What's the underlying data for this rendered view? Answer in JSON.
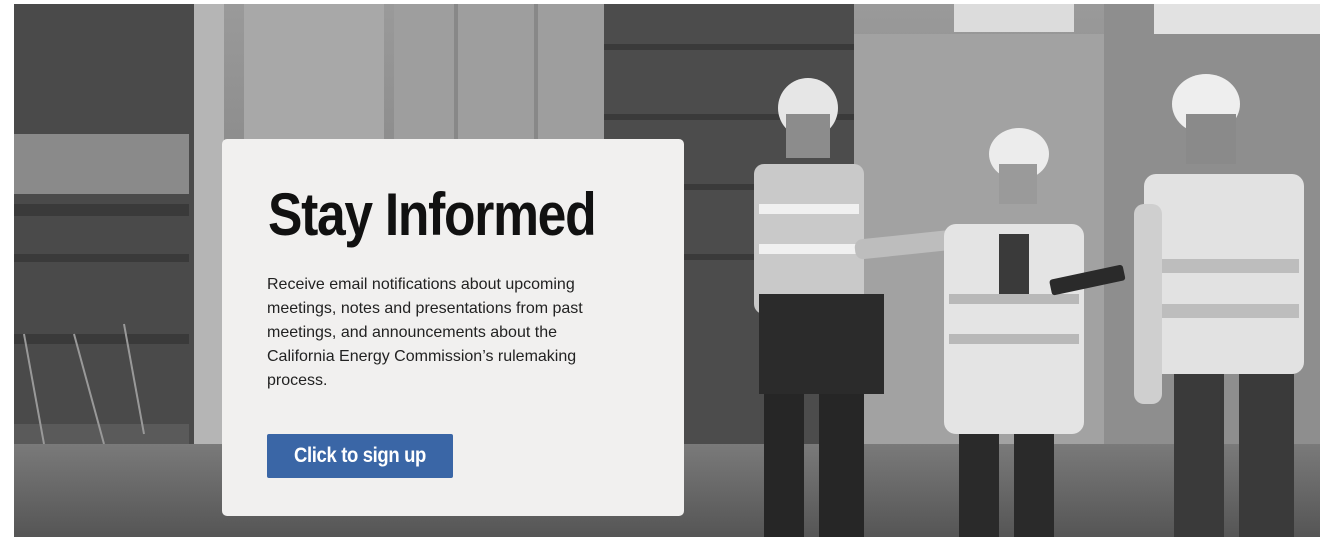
{
  "hero": {
    "title": "Stay Informed",
    "description": "Receive email notifications about upcoming meetings, notes and presentations from past meetings, and announcements about the California Energy Commission’s rulemaking process.",
    "cta_label": "Click to sign up",
    "background_image": "construction-site-workers-photo",
    "colors": {
      "card_background": "#f1f0ef",
      "button_background": "#3a66a6",
      "button_text": "#ffffff",
      "title_text": "#111111"
    }
  }
}
